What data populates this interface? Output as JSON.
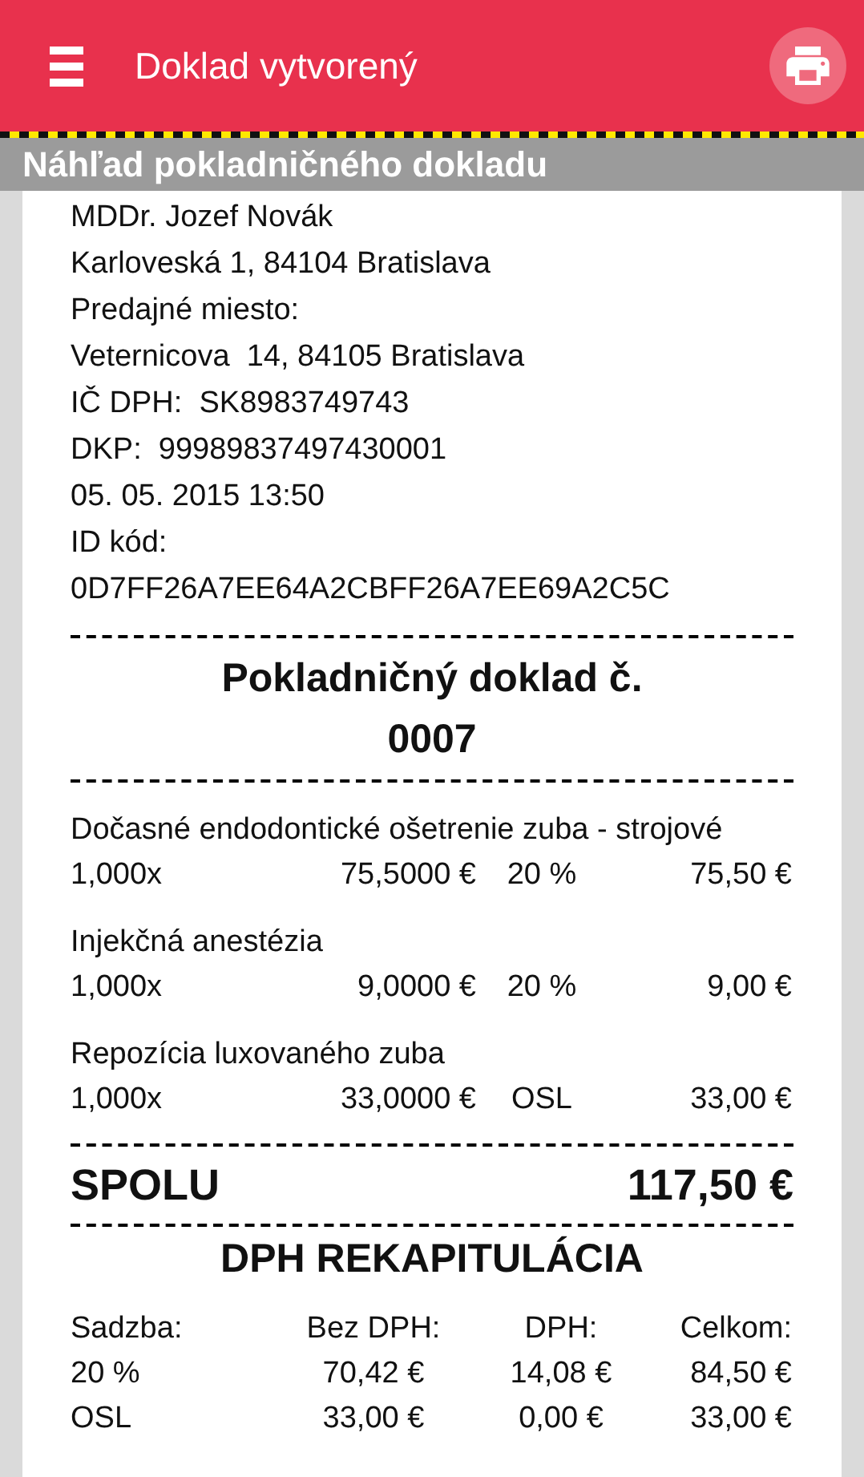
{
  "app_bar": {
    "title": "Doklad vytvorený"
  },
  "preview_title": "Náhľad pokladničného dokladu",
  "merchant_lines": [
    "MDDr. Jozef Novák",
    "Karloveská 1, 84104 Bratislava",
    "Predajné miesto:",
    "Veternicova  14, 84105 Bratislava",
    "IČ DPH:  SK8983749743",
    "DKP:  99989837497430001",
    "05. 05. 2015 13:50",
    "ID kód:",
    "0D7FF26A7EE64A2CBFF26A7EE69A2C5C"
  ],
  "receipt_heading": {
    "title": "Pokladničný doklad č.",
    "number": "0007"
  },
  "items": [
    {
      "name": "Dočasné endodontické ošetrenie zuba - strojové",
      "quantity": "1,000x",
      "unit_price": "75,5000 €",
      "vat": "20 %",
      "total": "75,50 €"
    },
    {
      "name": "Injekčná anestézia",
      "quantity": "1,000x",
      "unit_price": "9,0000 €",
      "vat": "20 %",
      "total": "9,00 €"
    },
    {
      "name": "Repozícia luxovaného zuba",
      "quantity": "1,000x",
      "unit_price": "33,0000 €",
      "vat": "OSL",
      "total": "33,00 €"
    }
  ],
  "total": {
    "label": "SPOLU",
    "value": "117,50 €"
  },
  "vat_summary": {
    "title": "DPH REKAPITULÁCIA",
    "columns": [
      "Sadzba:",
      "Bez DPH:",
      "DPH:",
      "Celkom:"
    ],
    "rows": [
      [
        "20 %",
        "70,42 €",
        "14,08 €",
        "84,50 €"
      ],
      [
        "OSL",
        "33,00 €",
        "0,00 €",
        "33,00 €"
      ]
    ]
  }
}
